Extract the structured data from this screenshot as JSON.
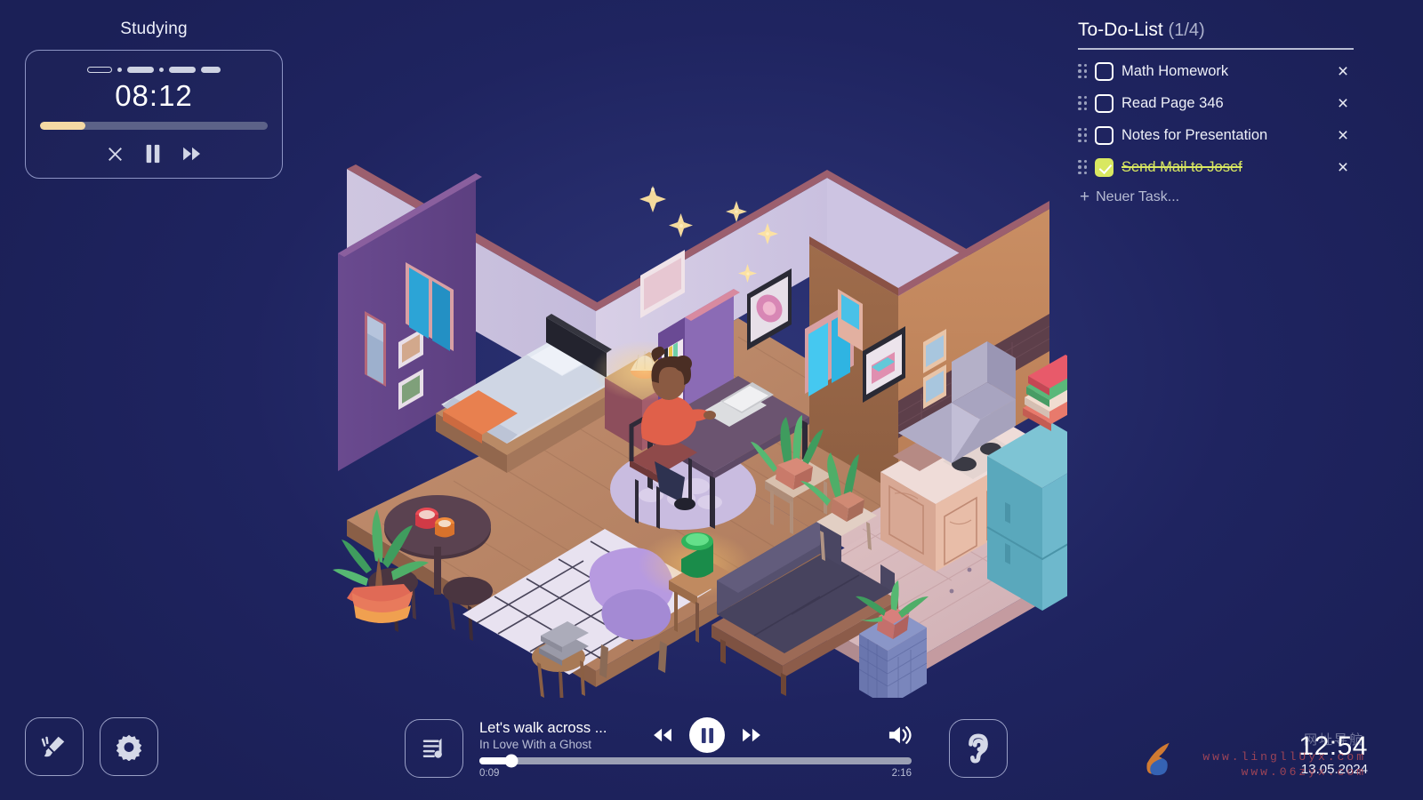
{
  "timer": {
    "session_label": "Studying",
    "time_display": "08:12",
    "progress_percent": 20,
    "segments": [
      "current-open",
      "dot",
      "filled",
      "dot",
      "filled",
      "filled-short"
    ],
    "controls": {
      "stop_label": "Stop",
      "pause_label": "Pause",
      "skip_label": "Skip"
    }
  },
  "todo": {
    "title": "To-Do-List",
    "count": "(1/4)",
    "items": [
      {
        "label": "Math Homework",
        "done": false,
        "delete_label": "×"
      },
      {
        "label": "Read Page 346",
        "done": false,
        "delete_label": "×"
      },
      {
        "label": "Notes for Presentation",
        "done": false,
        "delete_label": "×"
      },
      {
        "label": "Send Mail to Josef",
        "done": true,
        "delete_label": "×"
      }
    ],
    "add_label": "Neuer Task...",
    "add_plus": "+",
    "done_color": "#d9e861"
  },
  "bottom_left": {
    "customize_label": "Customize",
    "settings_label": "Settings"
  },
  "player": {
    "playlist_label": "Playlist",
    "track_title": "Let's walk across ...",
    "track_artist": "In Love With a Ghost",
    "current_time": "0:09",
    "total_time": "2:16",
    "progress_percent": 7.5,
    "prev_label": "Previous",
    "play_label": "Pause",
    "next_label": "Next",
    "volume_label": "Volume",
    "ambient_label": "Ambient Sounds"
  },
  "clock": {
    "time": "12:54",
    "date": "13.05.2024"
  },
  "watermark": {
    "line1": "www.lingllUyx.com",
    "line2": "www.06zyx.com",
    "cn": "网址导航"
  },
  "colors": {
    "background_deep": "#1b2057",
    "background_center": "#2e3577",
    "accent_warm": "#f5d9a4",
    "accent_lime": "#d9e861",
    "panel_border": "#9aa0c6"
  },
  "scene": {
    "name": "isometric-study-apartment",
    "rooms": [
      "bedroom",
      "study-desk",
      "living-room",
      "kitchen"
    ],
    "objects": [
      "bed",
      "bookshelf",
      "desk",
      "laptop",
      "character",
      "armchair",
      "sofa",
      "dining-table",
      "stools",
      "plants",
      "fridge",
      "stove",
      "range-hood",
      "rugs",
      "lamp",
      "fairy-lights",
      "wall-art",
      "mirror",
      "windows"
    ]
  }
}
